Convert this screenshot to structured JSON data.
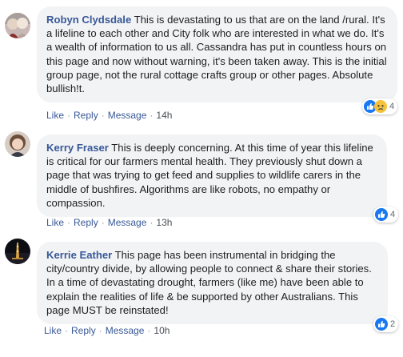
{
  "comments": [
    {
      "author": "Robyn Clydsdale",
      "text": "This is devastating to us that are on the land /rural. It's a lifeline to each other and City folk who are interested in what we do. It's a wealth of information to us all. Cassandra has put in countless hours on this page and now without warning, it's been taken away. This is the initial group page, not the rural cottage crafts group or other pages. Absolute bullish!t.",
      "like": "Like",
      "reply": "Reply",
      "message": "Message",
      "time": "14h",
      "reaction_count": "4",
      "reaction_icons": [
        "like-icon",
        "sad-icon"
      ]
    },
    {
      "author": "Kerry Fraser",
      "text": "This is deeply concerning. At this time of year this lifeline is critical for our farmers mental health. They previously shut down a page that was trying to get feed and supplies to wildlife carers in the middle of bushfires. Algorithms are like robots, no empathy or compassion.",
      "like": "Like",
      "reply": "Reply",
      "message": "Message",
      "time": "13h",
      "reaction_count": "4",
      "reaction_icons": [
        "like-icon"
      ]
    },
    {
      "author": "Kerrie Eather",
      "text": "This page has been instrumental in bridging the city/country divide, by allowing people to connect & share their stories. In a time of devastating drought, farmers (like me) have been able to explain the realities of life & be supported by other Australians. This page MUST be reinstated!",
      "like": "Like",
      "reply": "Reply",
      "message": "Message",
      "time": "10h",
      "reaction_count": "2",
      "reaction_icons": [
        "like-icon"
      ]
    }
  ],
  "separator": "·",
  "colors": {
    "author": "#385898",
    "bubble": "#f2f3f5",
    "like_blue": "#1877f2",
    "sad_yellow": "#f7c23a"
  }
}
